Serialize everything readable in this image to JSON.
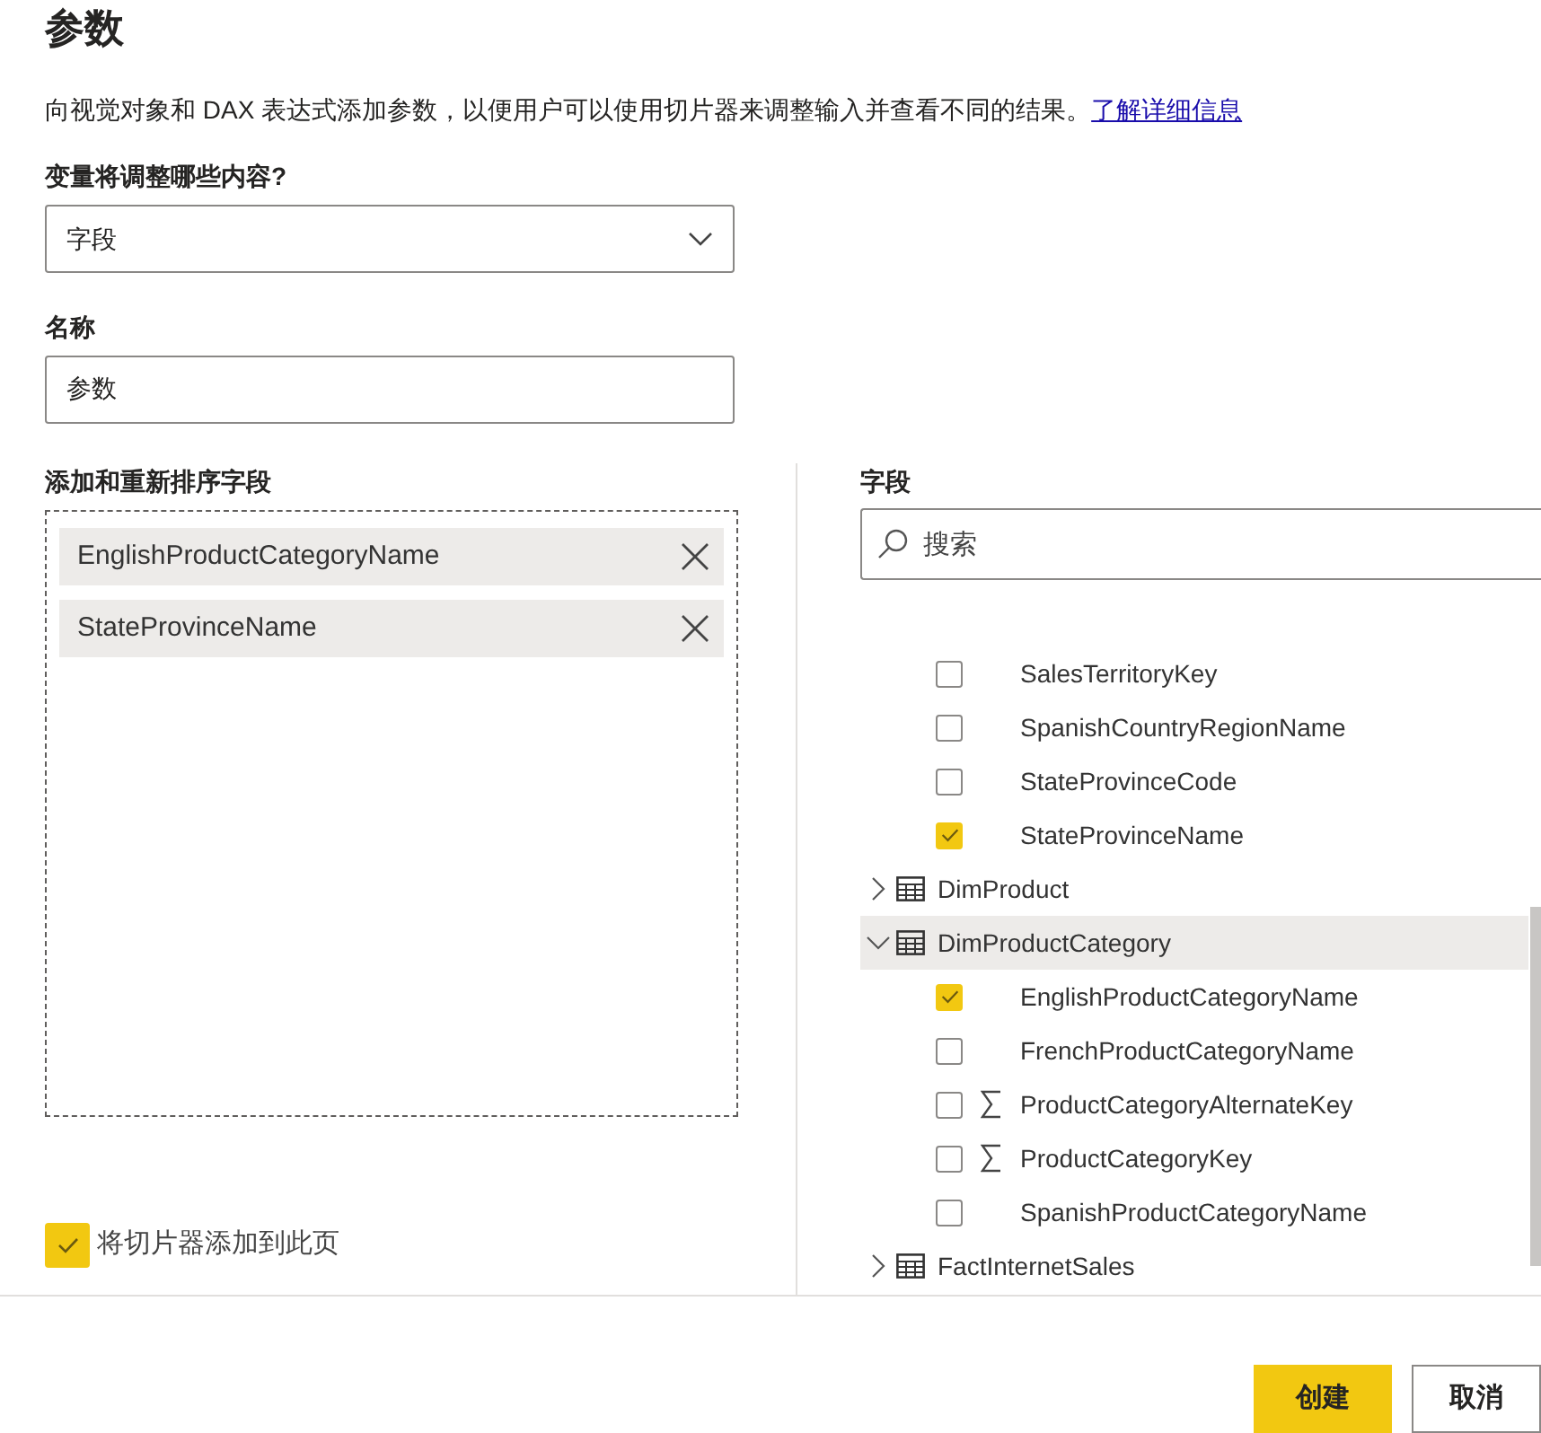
{
  "title": "参数",
  "description": "向视觉对象和 DAX 表达式添加参数，以便用户可以使用切片器来调整输入并查看不同的结果。",
  "learn_more_link": "了解详细信息",
  "variable_type": {
    "label": "变量将调整哪些内容?",
    "value": "字段"
  },
  "name": {
    "label": "名称",
    "value": "参数"
  },
  "selected_fields": {
    "label": "添加和重新排序字段",
    "items": [
      {
        "name": "EnglishProductCategoryName"
      },
      {
        "name": "StateProvinceName"
      }
    ]
  },
  "add_slicer": {
    "label": "将切片器添加到此页",
    "checked": true
  },
  "fields_panel": {
    "label": "字段",
    "search": {
      "placeholder": "搜索"
    },
    "items": [
      {
        "kind": "text",
        "name": "SalesTerritoryKey",
        "checked": false
      },
      {
        "kind": "text",
        "name": "SpanishCountryRegionName",
        "checked": false
      },
      {
        "kind": "text",
        "name": "StateProvinceCode",
        "checked": false
      },
      {
        "kind": "text",
        "name": "StateProvinceName",
        "checked": true
      },
      {
        "kind": "table",
        "name": "DimProduct",
        "expanded": false,
        "selected": false
      },
      {
        "kind": "table",
        "name": "DimProductCategory",
        "expanded": true,
        "selected": true,
        "children": [
          {
            "kind": "text",
            "name": "EnglishProductCategoryName",
            "checked": true
          },
          {
            "kind": "text",
            "name": "FrenchProductCategoryName",
            "checked": false
          },
          {
            "kind": "numeric",
            "name": "ProductCategoryAlternateKey",
            "checked": false
          },
          {
            "kind": "numeric",
            "name": "ProductCategoryKey",
            "checked": false
          },
          {
            "kind": "text",
            "name": "SpanishProductCategoryName",
            "checked": false
          }
        ]
      },
      {
        "kind": "table",
        "name": "FactInternetSales",
        "expanded": false,
        "selected": false
      }
    ]
  },
  "buttons": [
    {
      "kind": "primary",
      "label": "创建"
    },
    {
      "kind": "secondary",
      "label": "取消"
    }
  ]
}
